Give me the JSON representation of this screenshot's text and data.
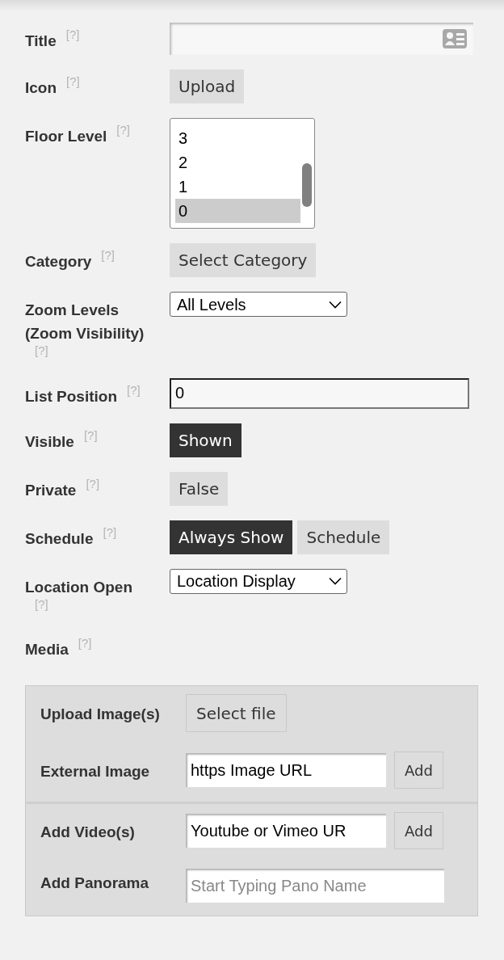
{
  "fields": [
    {
      "label": "Title",
      "help": "[?]",
      "kind": "text-input"
    },
    {
      "label": "Icon",
      "help": "[?]",
      "kind": "buttons",
      "buttons": [
        {
          "label": "Upload",
          "selected": false
        }
      ]
    },
    {
      "label": "Floor Level",
      "help": "[?]",
      "kind": "listbox",
      "options": [
        {
          "label": "3",
          "selected": false
        },
        {
          "label": "2",
          "selected": false
        },
        {
          "label": "1",
          "selected": false
        },
        {
          "label": "0",
          "selected": true
        }
      ]
    },
    {
      "label": "Category",
      "help": "[?]",
      "kind": "buttons",
      "buttons": [
        {
          "label": "Select Category",
          "selected": false
        }
      ]
    },
    {
      "label": "Zoom Levels (Zoom Visibility)",
      "help": "[?]",
      "kind": "select",
      "value": "All Levels"
    },
    {
      "label": "List Position",
      "help": "[?]",
      "kind": "number-input",
      "value": "0"
    },
    {
      "label": "Visible",
      "help": "[?]",
      "kind": "buttons",
      "buttons": [
        {
          "label": "Shown",
          "selected": true
        }
      ]
    },
    {
      "label": "Private",
      "help": "[?]",
      "kind": "buttons",
      "buttons": [
        {
          "label": "False",
          "selected": false
        }
      ]
    },
    {
      "label": "Schedule",
      "help": "[?]",
      "kind": "buttons",
      "buttons": [
        {
          "label": "Always Show",
          "selected": true
        },
        {
          "label": "Schedule",
          "selected": false
        }
      ]
    },
    {
      "label": "Location Open",
      "help": "[?]",
      "kind": "select",
      "value": "Location Display"
    },
    {
      "label": "Media",
      "help": "[?]",
      "kind": "heading"
    }
  ],
  "media": {
    "groups": [
      [
        {
          "label": "Upload Image(s)",
          "kind": "file",
          "button": "Select file"
        },
        {
          "label": "External Image",
          "kind": "url",
          "value": "https Image URL",
          "button": "Add"
        }
      ],
      [
        {
          "label": "Add Video(s)",
          "kind": "url",
          "value": "Youtube or Vimeo UR",
          "button": "Add"
        },
        {
          "label": "Add Panorama",
          "kind": "search",
          "placeholder": "Start Typing Pano Name"
        }
      ]
    ]
  }
}
